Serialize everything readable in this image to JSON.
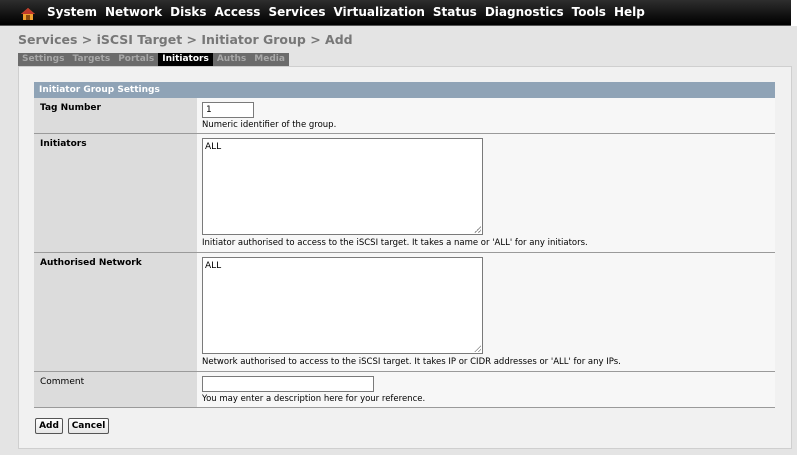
{
  "topnav": {
    "items": [
      "System",
      "Network",
      "Disks",
      "Access",
      "Services",
      "Virtualization",
      "Status",
      "Diagnostics",
      "Tools",
      "Help"
    ]
  },
  "breadcrumb": "Services > iSCSI Target > Initiator Group > Add",
  "tabs": [
    "Settings",
    "Targets",
    "Portals",
    "Initiators",
    "Auths",
    "Media"
  ],
  "active_tab": "Initiators",
  "section_title": "Initiator Group Settings",
  "fields": {
    "tag_number": {
      "label": "Tag Number",
      "value": "1",
      "help": "Numeric identifier of the group."
    },
    "initiators": {
      "label": "Initiators",
      "value": "ALL",
      "help": "Initiator authorised to access to the iSCSI target. It takes a name or 'ALL' for any initiators."
    },
    "authorised_network": {
      "label": "Authorised Network",
      "value": "ALL",
      "help": "Network authorised to access to the iSCSI target. It takes IP or CIDR addresses or 'ALL' for any IPs."
    },
    "comment": {
      "label": "Comment",
      "value": "",
      "help": "You may enter a description here for your reference."
    }
  },
  "buttons": {
    "add": "Add",
    "cancel": "Cancel"
  },
  "colors": {
    "nav_bg": "#000000",
    "section_header": "#8fa3b6",
    "active_tab_bg": "#000000"
  },
  "icons": {
    "home": "home-icon"
  }
}
